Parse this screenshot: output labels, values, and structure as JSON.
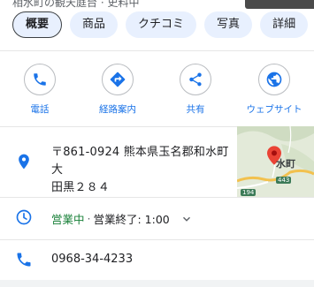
{
  "header_cut": {
    "text": "相水町の観天庭台 · 史料中"
  },
  "tabs": [
    {
      "label": "概要"
    },
    {
      "label": "商品"
    },
    {
      "label": "クチコミ"
    },
    {
      "label": "写真"
    },
    {
      "label": "詳細"
    }
  ],
  "actions": [
    {
      "label": "電話",
      "icon": "phone-icon"
    },
    {
      "label": "経路案内",
      "icon": "directions-icon"
    },
    {
      "label": "共有",
      "icon": "share-icon"
    },
    {
      "label": "ウェブサイト",
      "icon": "globe-icon"
    }
  ],
  "address": {
    "line1": "〒861-0924 熊本県玉名郡和水町大",
    "line2": "田黒２８４",
    "icon": "location-pin-icon"
  },
  "map": {
    "place_label": "水町",
    "road_badges": [
      "443",
      "194"
    ]
  },
  "hours": {
    "status": "営業中",
    "separator": "·",
    "close_text": "営業終了: 1:00",
    "icon": "clock-icon"
  },
  "phone": {
    "number": "0968-34-4233",
    "icon": "phone-icon"
  },
  "colors": {
    "accent": "#1a73e8",
    "open_green": "#188038",
    "tab_bg": "#e8f0fe",
    "pin_red": "#ea4335"
  }
}
